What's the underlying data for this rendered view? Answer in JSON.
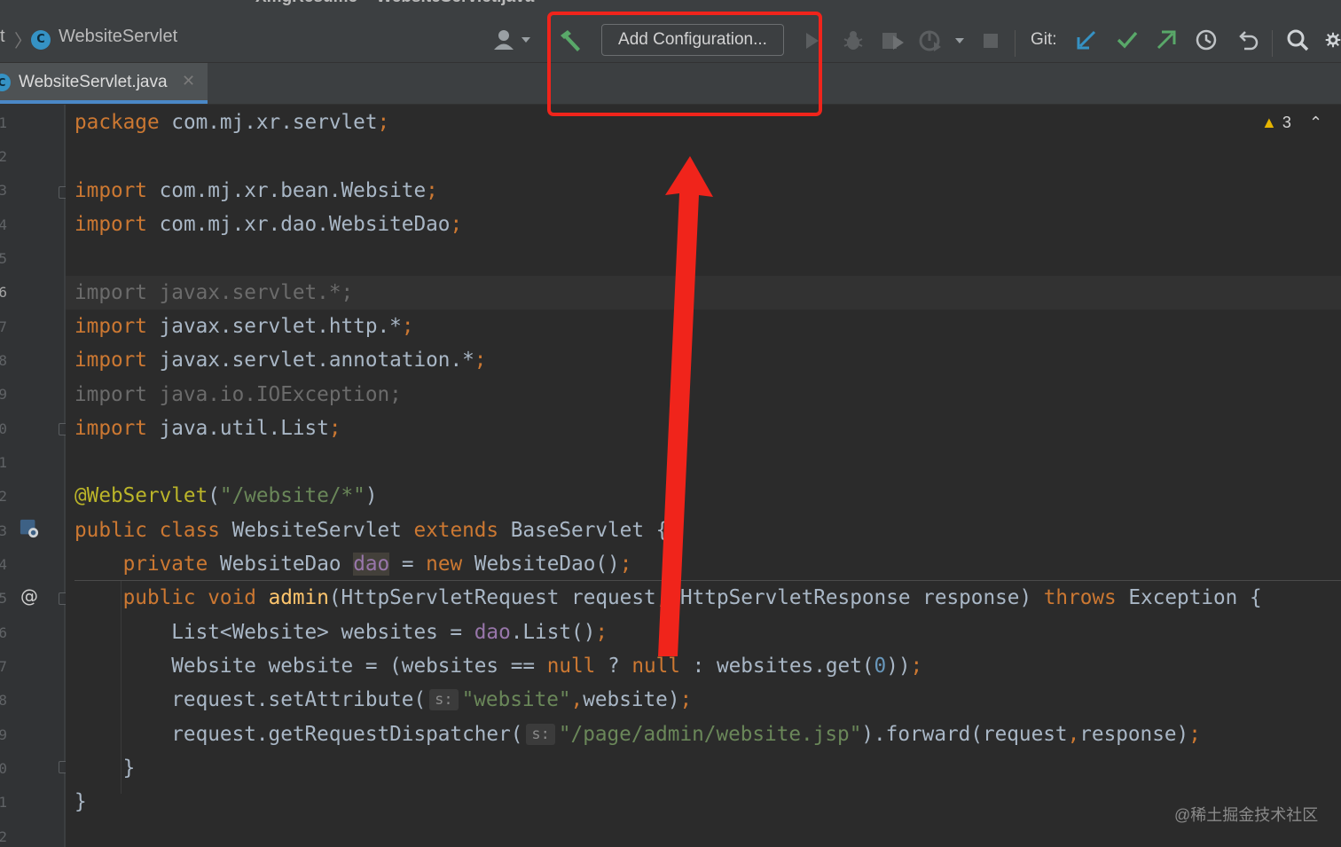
{
  "window": {
    "title": "XmgResume – WebsiteServlet.java"
  },
  "navbar": {
    "crumb_prev": "t",
    "crumb_current": "WebsiteServlet",
    "class_badge": "C"
  },
  "toolbar": {
    "add_configuration_label": "Add Configuration...",
    "git_label": "Git:",
    "icons": [
      "user-icon",
      "hammer-icon",
      "run-icon",
      "debug-icon",
      "coverage-icon",
      "profile-icon",
      "stop-icon",
      "git-update-icon",
      "git-commit-icon",
      "git-push-icon",
      "history-icon",
      "rollback-icon",
      "search-icon",
      "settings-icon"
    ],
    "colors": {
      "hammer": "#59a869",
      "git_update": "#3592c4",
      "git_commit": "#59a869",
      "git_push": "#59a869"
    }
  },
  "tabs": [
    {
      "label": "WebsiteServlet.java",
      "badge": "C",
      "active": true
    }
  ],
  "gutter": {
    "line_numbers": [
      "1",
      "2",
      "3",
      "4",
      "5",
      "6",
      "7",
      "8",
      "9",
      "0",
      "1",
      "2",
      "3",
      "4",
      "5",
      "6",
      "7",
      "8",
      "9",
      "0",
      "1",
      "2"
    ]
  },
  "editor": {
    "warnings_count": "3",
    "lines": [
      "package com.mj.xr.servlet;",
      "",
      "import com.mj.xr.bean.Website;",
      "import com.mj.xr.dao.WebsiteDao;",
      "",
      "import javax.servlet.*;",
      "import javax.servlet.http.*;",
      "import javax.servlet.annotation.*;",
      "import java.io.IOException;",
      "import java.util.List;",
      "",
      "@WebServlet(\"/website/*\")",
      "public class WebsiteServlet extends BaseServlet {",
      "    private WebsiteDao dao = new WebsiteDao();",
      "    public void admin(HttpServletRequest request, HttpServletResponse response) throws Exception {",
      "        List<Website> websites = dao.List();",
      "        Website website = (websites == null ? null : websites.get(0));",
      "        request.setAttribute( s: \"website\",website);",
      "        request.getRequestDispatcher( s: \"/page/admin/website.jsp\").forward(request,response);",
      "    }",
      "}"
    ],
    "param_hint": "s:"
  },
  "annotation": {
    "box_color": "#f0241b",
    "arrow_color": "#f0241b"
  },
  "watermark": "@稀土掘金技术社区"
}
